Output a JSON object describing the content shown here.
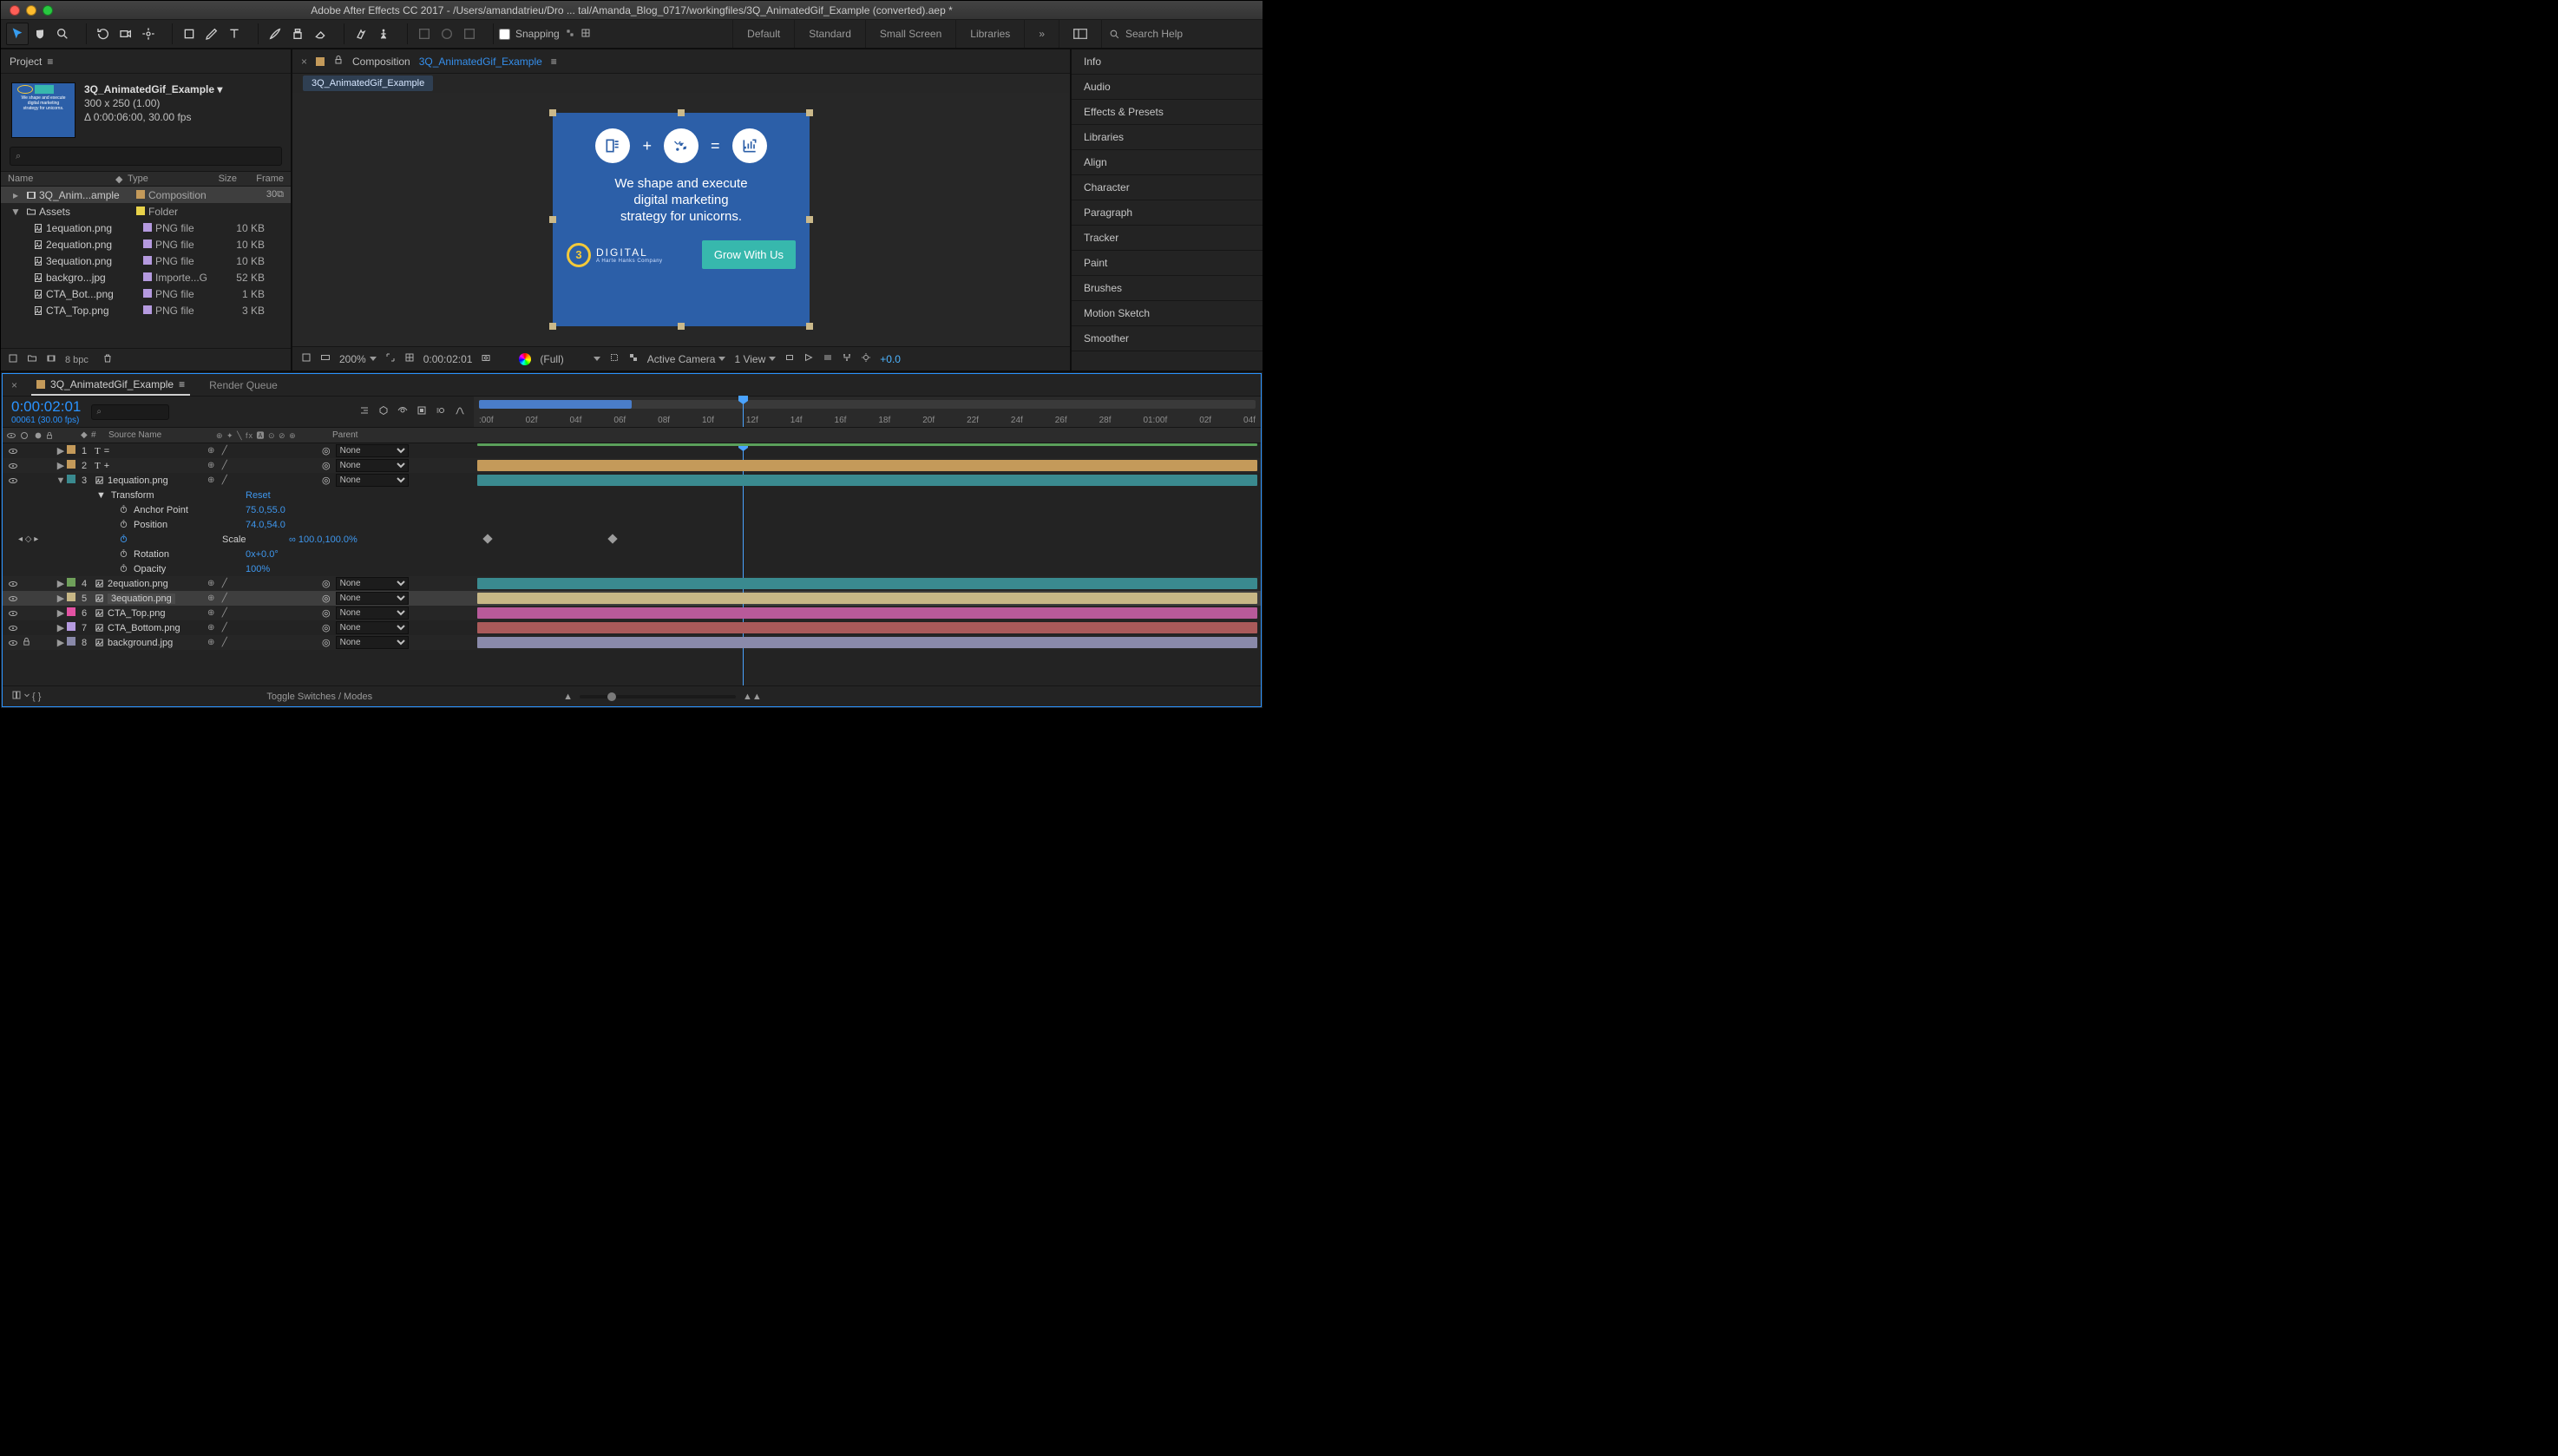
{
  "titlebar": {
    "title": "Adobe After Effects CC 2017 - /Users/amandatrieu/Dro ... tal/Amanda_Blog_0717/workingfiles/3Q_AnimatedGif_Example (converted).aep *"
  },
  "toolbar": {
    "snapping_label": "Snapping",
    "workspaces": [
      "Default",
      "Standard",
      "Small Screen",
      "Libraries"
    ],
    "search_placeholder": "Search Help"
  },
  "project": {
    "panel_title": "Project",
    "comp": {
      "name": "3Q_AnimatedGif_Example ▾",
      "dims": "300 x 250 (1.00)",
      "dur": "Δ 0:00:06:00, 30.00 fps"
    },
    "search_placeholder": "⌕",
    "columns": {
      "name": "Name",
      "type": "Type",
      "size": "Size",
      "frame": "Frame"
    },
    "items": [
      {
        "icon": "comp",
        "name": "3Q_Anim...ample",
        "tag": "#c49a5a",
        "type": "Composition",
        "size": "",
        "frame": "30⧉",
        "sel": true,
        "indent": 0
      },
      {
        "icon": "folder",
        "name": "Assets",
        "tag": "#e8d24a",
        "type": "Folder",
        "size": "",
        "frame": "",
        "indent": 0,
        "disc": "▼"
      },
      {
        "icon": "file",
        "name": "1equation.png",
        "tag": "#b59adf",
        "type": "PNG file",
        "size": "10 KB",
        "frame": "",
        "indent": 1
      },
      {
        "icon": "file",
        "name": "2equation.png",
        "tag": "#b59adf",
        "type": "PNG file",
        "size": "10 KB",
        "frame": "",
        "indent": 1
      },
      {
        "icon": "file",
        "name": "3equation.png",
        "tag": "#b59adf",
        "type": "PNG file",
        "size": "10 KB",
        "frame": "",
        "indent": 1
      },
      {
        "icon": "file",
        "name": "backgro...jpg",
        "tag": "#b59adf",
        "type": "Importe...G",
        "size": "52 KB",
        "frame": "",
        "indent": 1
      },
      {
        "icon": "file",
        "name": "CTA_Bot...png",
        "tag": "#b59adf",
        "type": "PNG file",
        "size": "1 KB",
        "frame": "",
        "indent": 1
      },
      {
        "icon": "file",
        "name": "CTA_Top.png",
        "tag": "#b59adf",
        "type": "PNG file",
        "size": "3 KB",
        "frame": "",
        "indent": 1
      }
    ],
    "footer_bpc": "8 bpc"
  },
  "composition": {
    "label": "Composition",
    "name": "3Q_AnimatedGif_Example",
    "nested_tab": "3Q_AnimatedGif_Example",
    "ad": {
      "line1": "We shape and execute",
      "line2": "digital marketing",
      "line3": "strategy for unicorns.",
      "logo_text": "DIGITAL",
      "logo_num": "3",
      "cta": "Grow With Us"
    },
    "footer": {
      "zoom": "200%",
      "timecode": "0:00:02:01",
      "res": "(Full)",
      "camera": "Active Camera",
      "view": "1 View",
      "exposure": "+0.0"
    }
  },
  "right_panels": [
    "Info",
    "Audio",
    "Effects & Presets",
    "Libraries",
    "Align",
    "Character",
    "Paragraph",
    "Tracker",
    "Paint",
    "Brushes",
    "Motion Sketch",
    "Smoother"
  ],
  "timeline": {
    "tab": "3Q_AnimatedGif_Example",
    "render_queue": "Render Queue",
    "timecode": "0:00:02:01",
    "sub_timecode": "00061 (30.00 fps)",
    "col_source": "Source Name",
    "col_parent": "Parent",
    "ruler_ticks": [
      ":00f",
      "02f",
      "04f",
      "06f",
      "08f",
      "10f",
      "12f",
      "14f",
      "16f",
      "18f",
      "20f",
      "22f",
      "24f",
      "26f",
      "28f",
      "01:00f",
      "02f",
      "04f"
    ],
    "layers": [
      {
        "num": "1",
        "color": "#c49a5a",
        "icon": "T",
        "name": "=",
        "parent": "None",
        "bar": "#5aa05a",
        "bar_top": true
      },
      {
        "num": "2",
        "color": "#c49a5a",
        "icon": "T",
        "name": "+",
        "parent": "None",
        "bar": "#c49a5a"
      },
      {
        "num": "3",
        "color": "#3a8a8f",
        "icon": "img",
        "name": "1equation.png",
        "parent": "None",
        "bar": "#3a8a8f",
        "open": true
      },
      {
        "num": "4",
        "color": "#6fa05a",
        "icon": "img",
        "name": "2equation.png",
        "parent": "None",
        "bar": "#3a8a8f"
      },
      {
        "num": "5",
        "color": "#c7b786",
        "icon": "img",
        "name": "3equation.png",
        "parent": "None",
        "bar": "#c7b786",
        "sel": true
      },
      {
        "num": "6",
        "color": "#e352a3",
        "icon": "img",
        "name": "CTA_Top.png",
        "parent": "None",
        "bar": "#b85a9a"
      },
      {
        "num": "7",
        "color": "#b59adf",
        "icon": "img",
        "name": "CTA_Bottom.png",
        "parent": "None",
        "bar": "#aa5a5a"
      },
      {
        "num": "8",
        "color": "#8a8aaa",
        "icon": "img",
        "name": "background.jpg",
        "parent": "None",
        "bar": "#8a8aaa",
        "locked": true
      }
    ],
    "transform": {
      "label": "Transform",
      "reset": "Reset",
      "props": [
        {
          "name": "Anchor Point",
          "val": "75.0,55.0",
          "sw": true
        },
        {
          "name": "Position",
          "val": "74.0,54.0",
          "sw": true
        },
        {
          "name": "Scale",
          "val": "∞ 100.0,100.0%",
          "sw": true,
          "key": true,
          "active": true
        },
        {
          "name": "Rotation",
          "val": "0x+0.0°",
          "sw": true
        },
        {
          "name": "Opacity",
          "val": "100%",
          "sw": true
        }
      ]
    },
    "footer_toggle": "Toggle Switches / Modes"
  }
}
